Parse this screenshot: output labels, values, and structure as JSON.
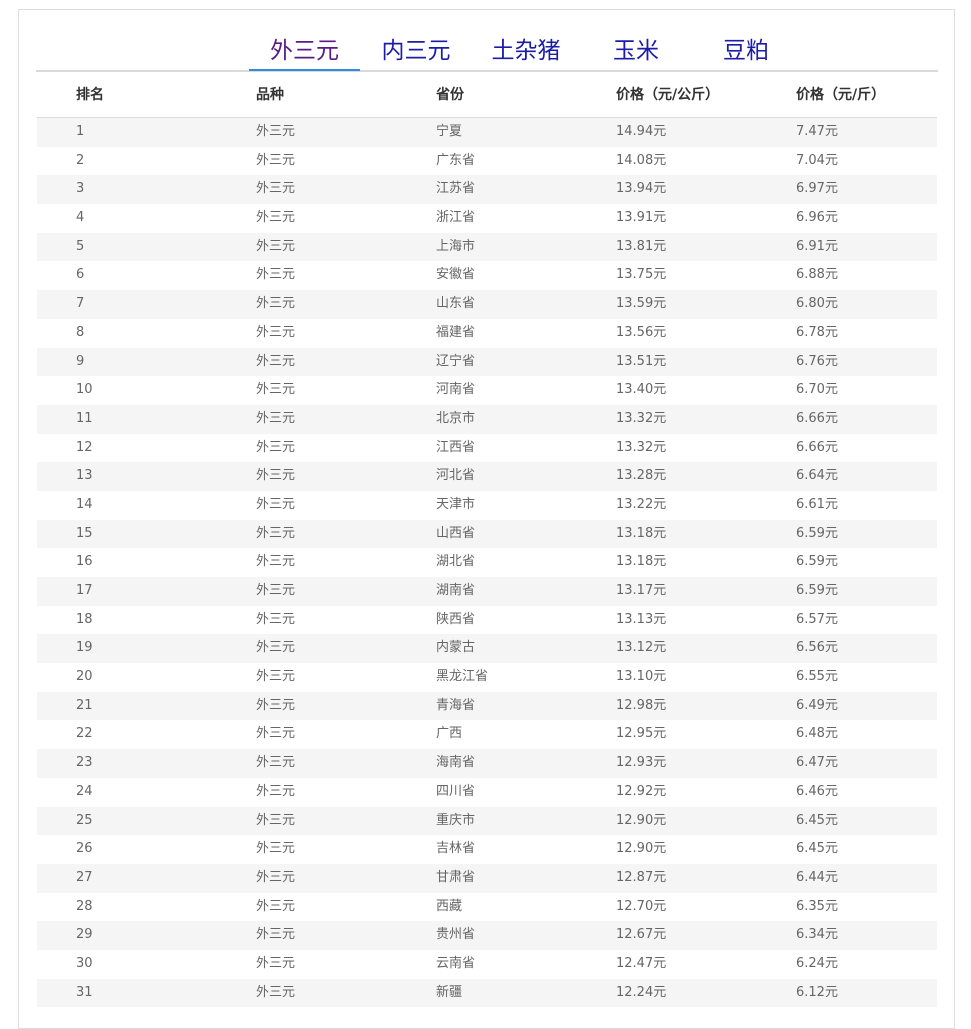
{
  "tabs": [
    {
      "label": "外三元",
      "active": true
    },
    {
      "label": "内三元",
      "active": false
    },
    {
      "label": "土杂猪",
      "active": false
    },
    {
      "label": "玉米",
      "active": false
    },
    {
      "label": "豆粕",
      "active": false
    }
  ],
  "columns": [
    "排名",
    "品种",
    "省份",
    "价格（元/公斤）",
    "价格（元/斤）"
  ],
  "rows": [
    [
      "1",
      "外三元",
      "宁夏",
      "14.94元",
      "7.47元"
    ],
    [
      "2",
      "外三元",
      "广东省",
      "14.08元",
      "7.04元"
    ],
    [
      "3",
      "外三元",
      "江苏省",
      "13.94元",
      "6.97元"
    ],
    [
      "4",
      "外三元",
      "浙江省",
      "13.91元",
      "6.96元"
    ],
    [
      "5",
      "外三元",
      "上海市",
      "13.81元",
      "6.91元"
    ],
    [
      "6",
      "外三元",
      "安徽省",
      "13.75元",
      "6.88元"
    ],
    [
      "7",
      "外三元",
      "山东省",
      "13.59元",
      "6.80元"
    ],
    [
      "8",
      "外三元",
      "福建省",
      "13.56元",
      "6.78元"
    ],
    [
      "9",
      "外三元",
      "辽宁省",
      "13.51元",
      "6.76元"
    ],
    [
      "10",
      "外三元",
      "河南省",
      "13.40元",
      "6.70元"
    ],
    [
      "11",
      "外三元",
      "北京市",
      "13.32元",
      "6.66元"
    ],
    [
      "12",
      "外三元",
      "江西省",
      "13.32元",
      "6.66元"
    ],
    [
      "13",
      "外三元",
      "河北省",
      "13.28元",
      "6.64元"
    ],
    [
      "14",
      "外三元",
      "天津市",
      "13.22元",
      "6.61元"
    ],
    [
      "15",
      "外三元",
      "山西省",
      "13.18元",
      "6.59元"
    ],
    [
      "16",
      "外三元",
      "湖北省",
      "13.18元",
      "6.59元"
    ],
    [
      "17",
      "外三元",
      "湖南省",
      "13.17元",
      "6.59元"
    ],
    [
      "18",
      "外三元",
      "陕西省",
      "13.13元",
      "6.57元"
    ],
    [
      "19",
      "外三元",
      "内蒙古",
      "13.12元",
      "6.56元"
    ],
    [
      "20",
      "外三元",
      "黑龙江省",
      "13.10元",
      "6.55元"
    ],
    [
      "21",
      "外三元",
      "青海省",
      "12.98元",
      "6.49元"
    ],
    [
      "22",
      "外三元",
      "广西",
      "12.95元",
      "6.48元"
    ],
    [
      "23",
      "外三元",
      "海南省",
      "12.93元",
      "6.47元"
    ],
    [
      "24",
      "外三元",
      "四川省",
      "12.92元",
      "6.46元"
    ],
    [
      "25",
      "外三元",
      "重庆市",
      "12.90元",
      "6.45元"
    ],
    [
      "26",
      "外三元",
      "吉林省",
      "12.90元",
      "6.45元"
    ],
    [
      "27",
      "外三元",
      "甘肃省",
      "12.87元",
      "6.44元"
    ],
    [
      "28",
      "外三元",
      "西藏",
      "12.70元",
      "6.35元"
    ],
    [
      "29",
      "外三元",
      "贵州省",
      "12.67元",
      "6.34元"
    ],
    [
      "30",
      "外三元",
      "云南省",
      "12.47元",
      "6.24元"
    ],
    [
      "31",
      "外三元",
      "新疆",
      "12.24元",
      "6.12元"
    ]
  ]
}
